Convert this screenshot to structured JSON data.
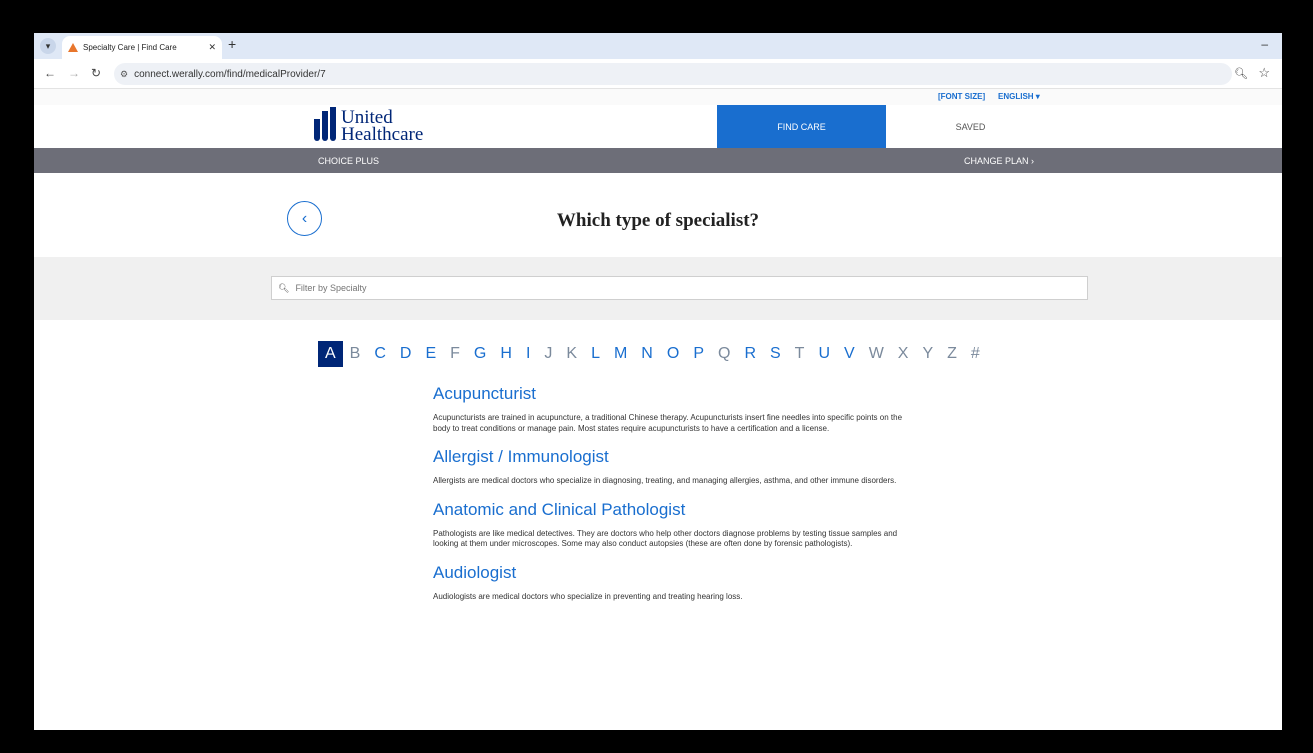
{
  "browser": {
    "tab_title": "Specialty Care | Find Care",
    "url": "connect.werally.com/find/medicalProvider/7"
  },
  "utility": {
    "font_size": "[FONT SIZE]",
    "language": "ENGLISH ▾"
  },
  "header": {
    "logo_line1": "United",
    "logo_line2": "Healthcare",
    "nav_find_care": "FIND CARE",
    "nav_saved": "SAVED"
  },
  "plan": {
    "name": "CHOICE PLUS",
    "change_label": "CHANGE PLAN ›"
  },
  "page": {
    "title": "Which type of specialist?",
    "filter_placeholder": "Filter by Specialty"
  },
  "alphabet": {
    "active": "A",
    "letters": [
      "A",
      "B",
      "C",
      "D",
      "E",
      "F",
      "G",
      "H",
      "I",
      "J",
      "K",
      "L",
      "M",
      "N",
      "O",
      "P",
      "Q",
      "R",
      "S",
      "T",
      "U",
      "V",
      "W",
      "X",
      "Y",
      "Z",
      "#"
    ],
    "disabled": [
      "B",
      "F",
      "J",
      "K",
      "Q",
      "T",
      "W",
      "X",
      "Y",
      "Z",
      "#"
    ]
  },
  "specialties": [
    {
      "name": "Acupuncturist",
      "description": "Acupuncturists are trained in acupuncture, a traditional Chinese therapy. Acupuncturists insert fine needles into specific points on the body to treat conditions or manage pain. Most states require acupuncturists to have a certification and a license."
    },
    {
      "name": "Allergist / Immunologist",
      "description": "Allergists are medical doctors who specialize in diagnosing, treating, and managing allergies, asthma, and other immune disorders."
    },
    {
      "name": "Anatomic and Clinical Pathologist",
      "description": "Pathologists are like medical detectives. They are doctors who help other doctors diagnose problems by testing tissue samples and looking at them under microscopes. Some may also conduct autopsies (these are often done by forensic pathologists)."
    },
    {
      "name": "Audiologist",
      "description": "Audiologists are medical doctors who specialize in preventing and treating hearing loss."
    }
  ],
  "colors": {
    "brand_blue": "#196ecf",
    "brand_navy": "#002677",
    "plan_bar": "#6d6e78"
  }
}
